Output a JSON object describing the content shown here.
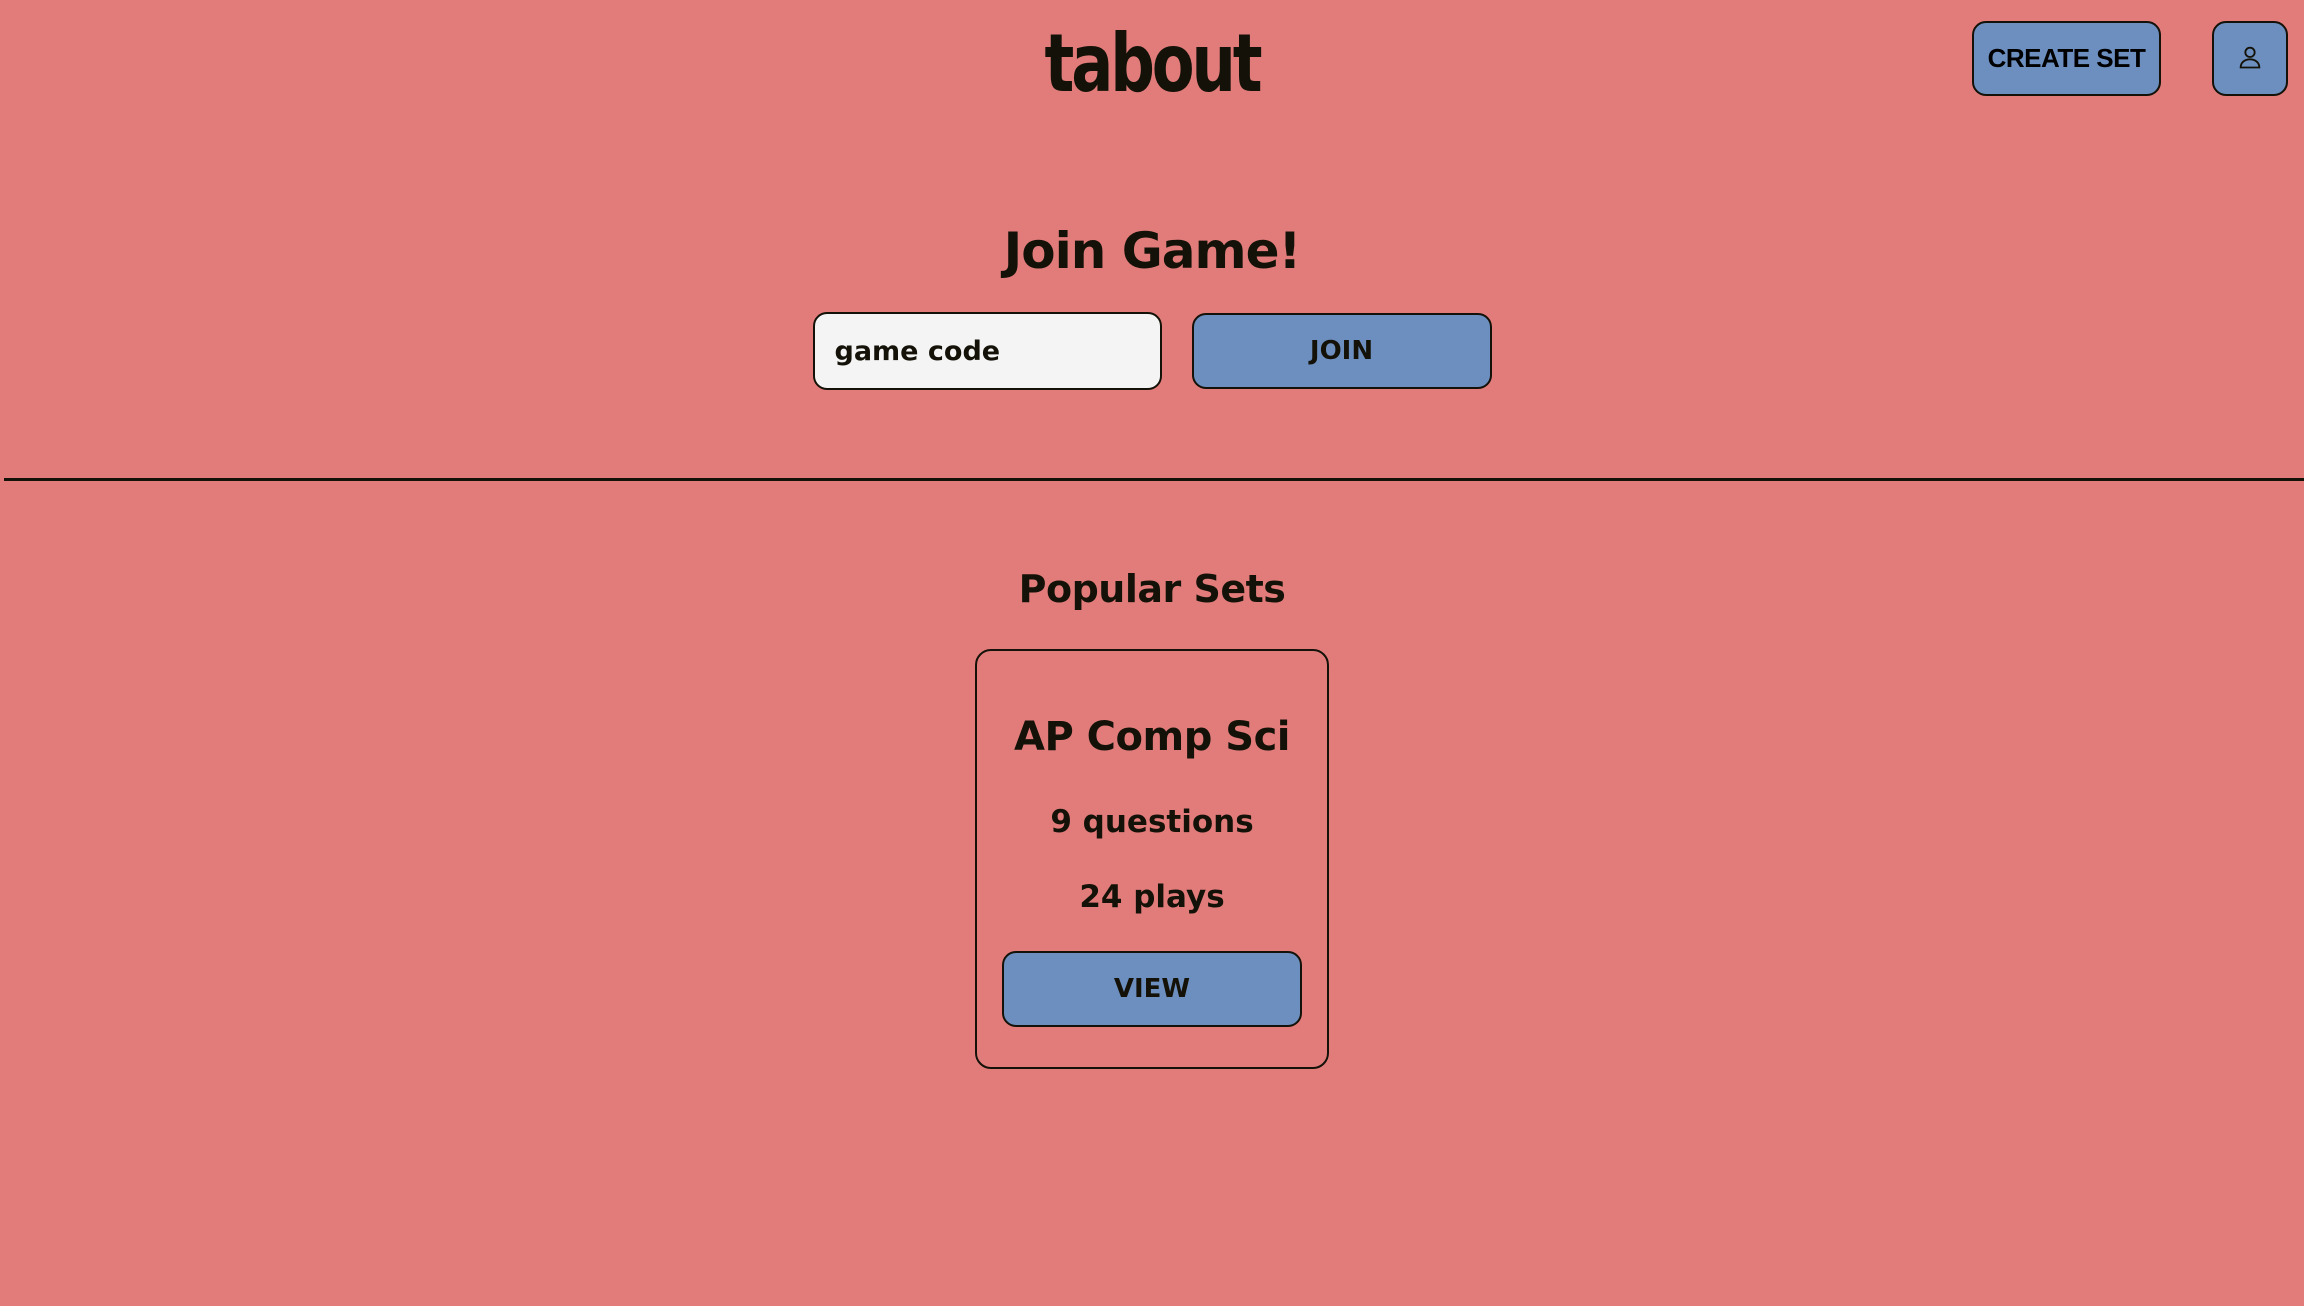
{
  "header": {
    "logo_text": "tabout",
    "create_set_label": "CREATE SET",
    "profile_icon": "user-icon"
  },
  "join": {
    "title": "Join Game!",
    "code_placeholder": "game code",
    "code_value": "",
    "join_label": "JOIN"
  },
  "popular": {
    "title": "Popular Sets",
    "sets": [
      {
        "title": "AP Comp Sci",
        "questions": "9 questions",
        "plays": "24 plays",
        "view_label": "VIEW"
      }
    ]
  },
  "colors": {
    "background": "#e17c7b",
    "button": "#6c8fc0",
    "input_bg": "#f4f4f4",
    "text": "#141208"
  }
}
